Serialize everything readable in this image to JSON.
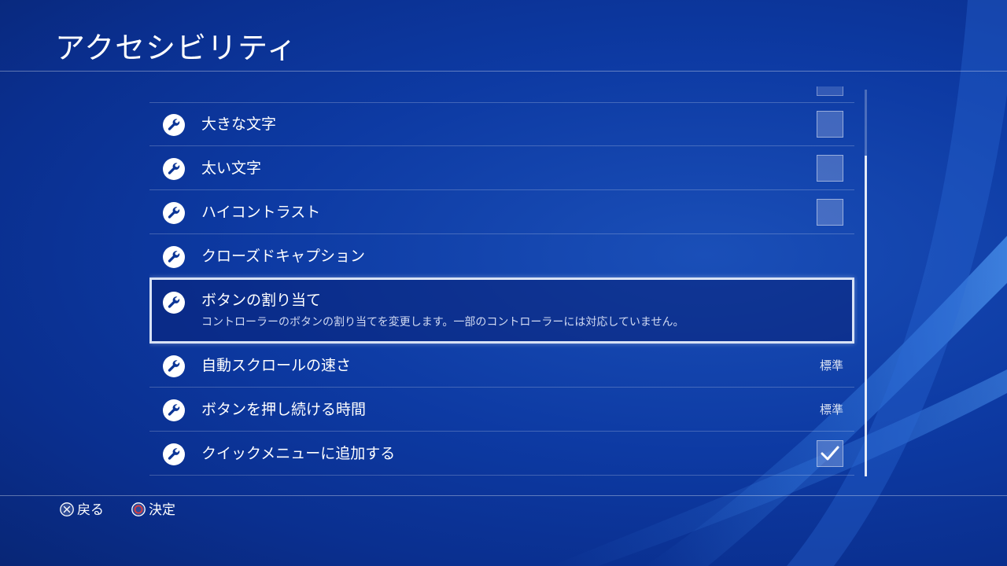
{
  "page": {
    "title": "アクセシビリティ"
  },
  "colors": {
    "selection_border": "#d8e2f5",
    "circle_button": "#e03a3a"
  },
  "settings": [
    {
      "label": "大きな文字",
      "control": "checkbox",
      "checked": false,
      "icon": "wrench-icon"
    },
    {
      "label": "太い文字",
      "control": "checkbox",
      "checked": false,
      "icon": "wrench-icon"
    },
    {
      "label": "ハイコントラスト",
      "control": "checkbox",
      "checked": false,
      "icon": "wrench-icon"
    },
    {
      "label": "クローズドキャプション",
      "control": "none",
      "icon": "wrench-icon"
    },
    {
      "label": "ボタンの割り当て",
      "description": "コントローラーのボタンの割り当てを変更します。一部のコントローラーには対応していません。",
      "selected": true,
      "icon": "wrench-icon"
    },
    {
      "label": "自動スクロールの速さ",
      "value": "標準",
      "icon": "wrench-icon"
    },
    {
      "label": "ボタンを押し続ける時間",
      "value": "標準",
      "icon": "wrench-icon"
    },
    {
      "label": "クイックメニューに追加する",
      "control": "checkbox",
      "checked": true,
      "icon": "wrench-icon"
    }
  ],
  "footer": {
    "back_label": "戻る",
    "back_icon": "cross-button-icon",
    "confirm_label": "決定",
    "confirm_icon": "circle-button-icon"
  }
}
